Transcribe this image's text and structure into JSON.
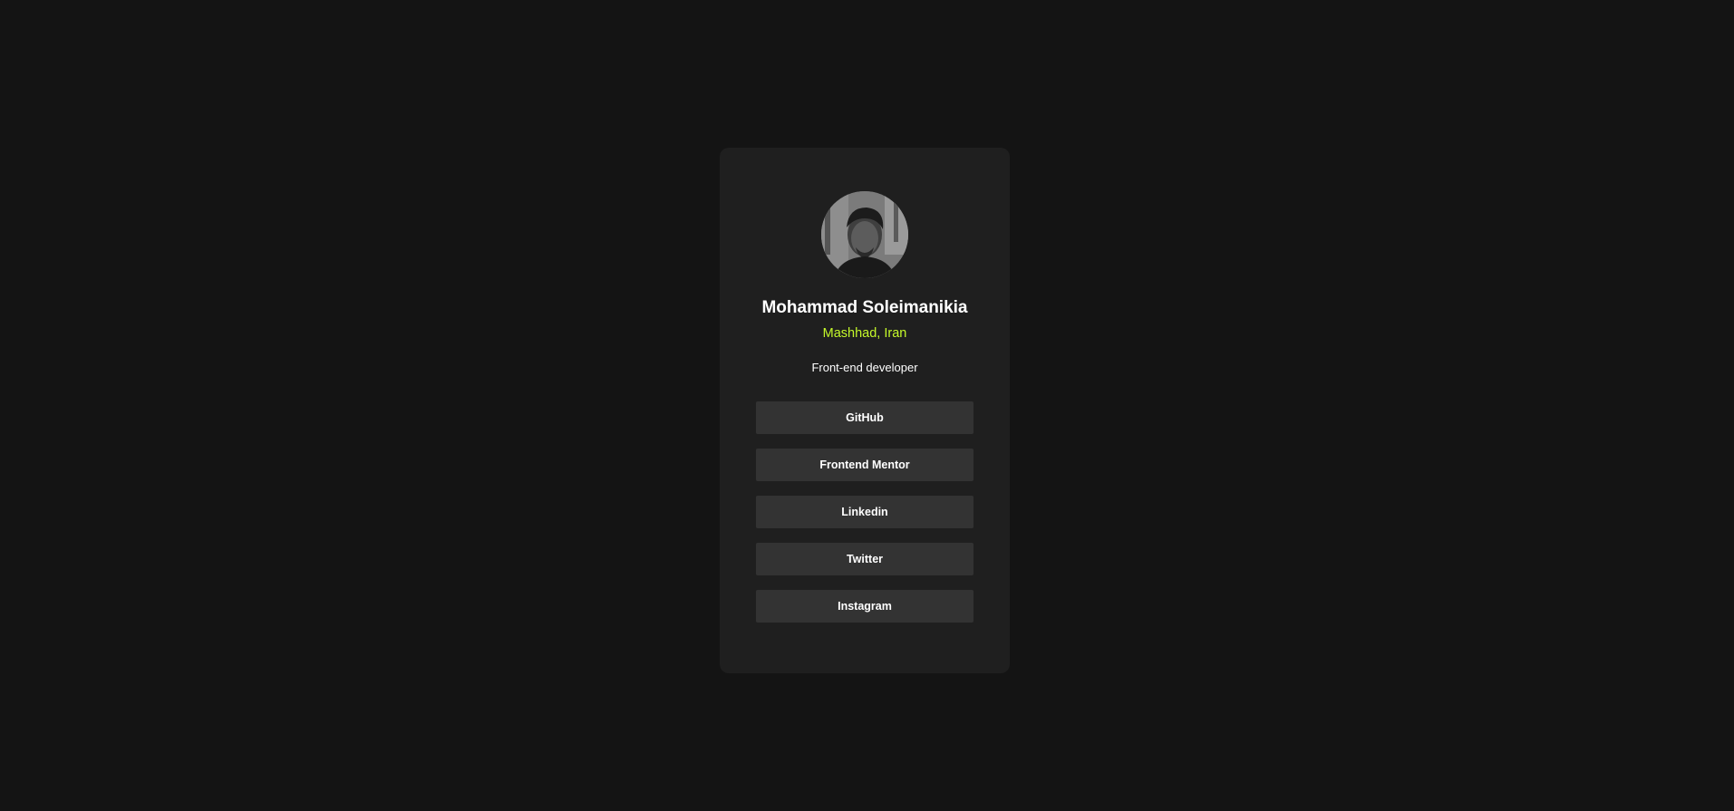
{
  "profile": {
    "name": "Mohammad Soleimanikia",
    "location": "Mashhad, Iran",
    "bio": "Front-end developer",
    "avatar_alt": "Profile photo"
  },
  "links": [
    {
      "label": "GitHub"
    },
    {
      "label": "Frontend Mentor"
    },
    {
      "label": "Linkedin"
    },
    {
      "label": "Twitter"
    },
    {
      "label": "Instagram"
    }
  ],
  "colors": {
    "page_background": "#141414",
    "card_background": "#1f1f1f",
    "button_background": "#333333",
    "accent": "#c4f82a",
    "text": "#ffffff"
  }
}
